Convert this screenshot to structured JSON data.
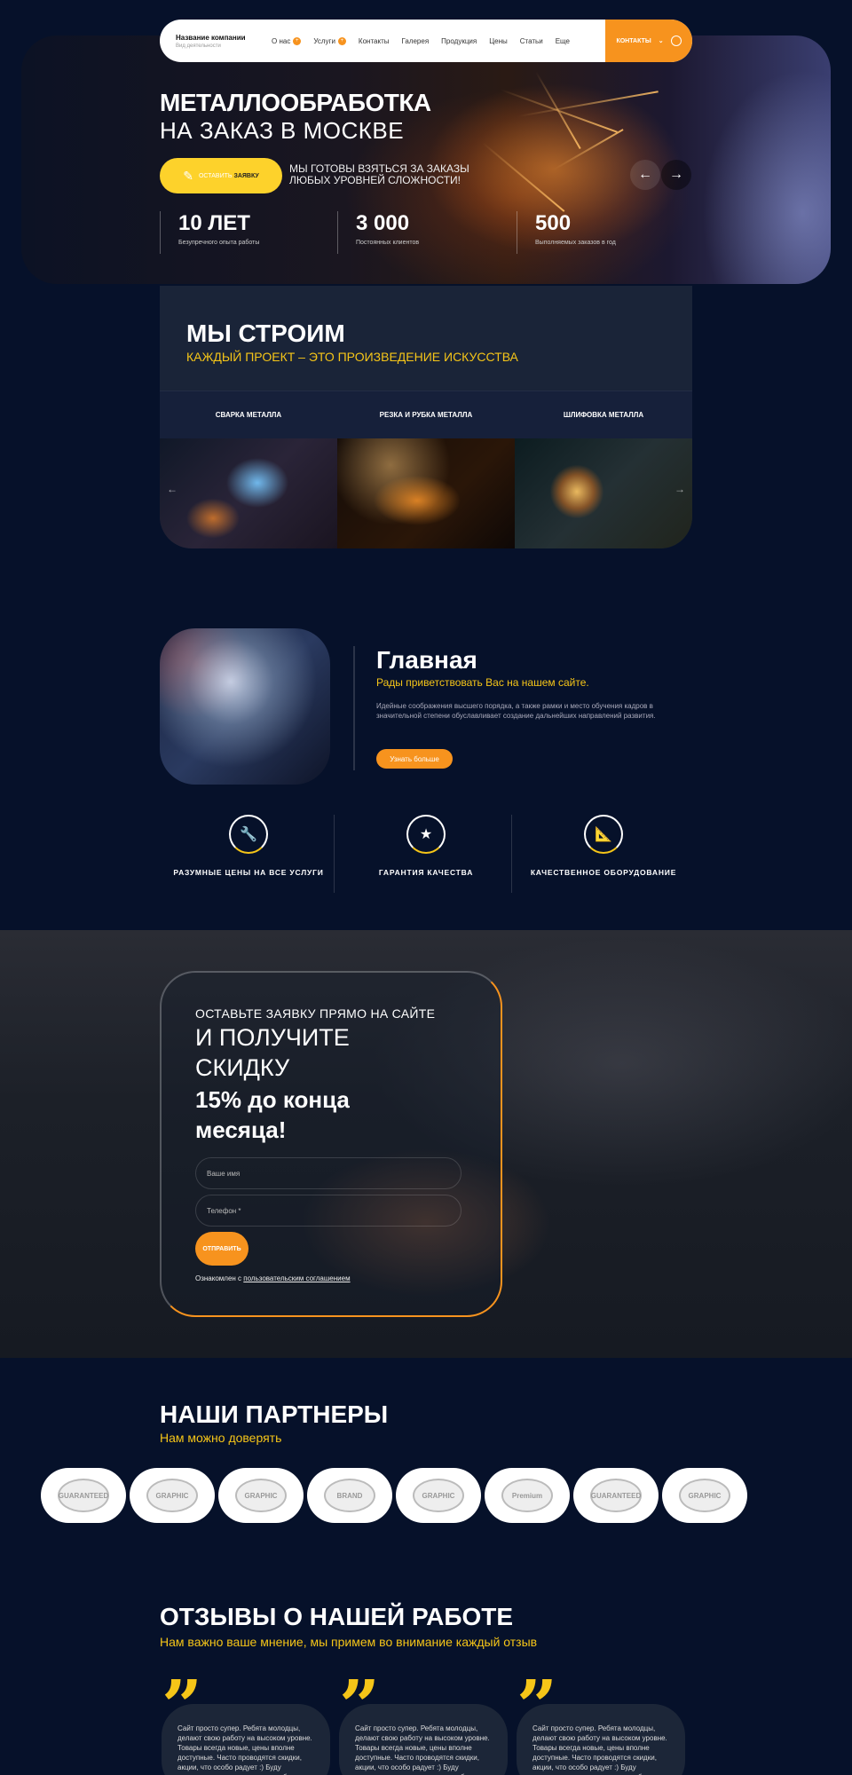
{
  "header": {
    "company_name": "Название компании",
    "company_sub": "Вид деятельности",
    "nav": [
      {
        "label": "О нас",
        "badge": "+"
      },
      {
        "label": "Услуги",
        "badge": "+"
      },
      {
        "label": "Контакты"
      },
      {
        "label": "Галерея"
      },
      {
        "label": "Продукция"
      },
      {
        "label": "Цены"
      },
      {
        "label": "Статьи"
      },
      {
        "label": "Еще"
      }
    ],
    "contacts_label": "КОНТАКТЫ"
  },
  "hero": {
    "title": "МЕТАЛЛООБРАБОТКА",
    "subtitle": "НА ЗАКАЗ В МОСКВЕ",
    "button_prefix": "ОСТАВИТЬ",
    "button_bold": "ЗАЯВКУ",
    "tagline": "МЫ ГОТОВЫ ВЗЯТЬСЯ ЗА ЗАКАЗЫ ЛЮБЫХ УРОВНЕЙ СЛОЖНОСТИ!",
    "stats": [
      {
        "value": "10 ЛЕТ",
        "label": "Безупречного опыта работы"
      },
      {
        "value": "3 000",
        "label": "Постоянных клиентов"
      },
      {
        "value": "500",
        "label": "Выполняемых заказов в год"
      }
    ]
  },
  "build": {
    "title": "МЫ СТРОИМ",
    "subtitle": "КАЖДЫЙ ПРОЕКТ – ЭТО ПРОИЗВЕДЕНИЕ ИСКУССТВА",
    "tabs": [
      "СВАРКА МЕТАЛЛА",
      "РЕЗКА И РУБКА МЕТАЛЛА",
      "ШЛИФОВКА МЕТАЛЛА"
    ]
  },
  "main": {
    "title": "Главная",
    "subtitle": "Рады приветствовать Вас на нашем сайте.",
    "text": "Идейные соображения высшего порядка, а также рамки и место обучения кадров в значительной степени обуславливает создание дальнейших направлений развития.",
    "button": "Узнать больше",
    "features": [
      {
        "label": "РАЗУМНЫЕ ЦЕНЫ НА ВСЕ УСЛУГИ",
        "icon": "wrench-icon"
      },
      {
        "label": "ГАРАНТИЯ КАЧЕСТВА",
        "icon": "medal-icon"
      },
      {
        "label": "КАЧЕСТВЕННОЕ ОБОРУДОВАНИЕ",
        "icon": "ruler-icon"
      }
    ]
  },
  "discount": {
    "line1": "ОСТАВЬТЕ ЗАЯВКУ ПРЯМО НА САЙТЕ",
    "line2": "И ПОЛУЧИТЕ СКИДКУ",
    "line3": "15% до конца месяца!",
    "name_placeholder": "Ваше имя",
    "phone_placeholder": "Телефон *",
    "submit": "ОТПРАВИТЬ",
    "agree_prefix": "Ознакомлен с",
    "agree_link": "пользовательским соглашением"
  },
  "partners": {
    "title": "НАШИ ПАРТНЕРЫ",
    "subtitle": "Нам можно доверять",
    "logos": [
      "GUARANTEED",
      "GRAPHIC",
      "GRAPHIC",
      "BRAND",
      "GRAPHIC",
      "Premium",
      "GUARANTEED",
      "GRAPHIC"
    ]
  },
  "reviews": {
    "title": "ОТЗЫВЫ О НАШЕЙ РАБОТЕ",
    "subtitle": "Нам важно ваше мнение, мы примем во внимание каждый отзыв",
    "items": [
      "Сайт просто супер. Ребята молодцы, делают свою работу на высоком уровне. Товары всегда новые, цены вполне доступные. Часто проводятся скидки, акции, что особо радует :) Буду рекомендовать всем друзьям и близким.",
      "Сайт просто супер. Ребята молодцы, делают свою работу на высоком уровне. Товары всегда новые, цены вполне доступные. Часто проводятся скидки, акции, что особо радует :) Буду рекомендовать всем друзьям и близким.",
      "Сайт просто супер. Ребята молодцы, делают свою работу на высоком уровне. Товары всегда новые, цены вполне доступные. Часто проводятся скидки, акции, что особо радует :) Буду рекомендовать всем друзьям и близким."
    ]
  },
  "colors": {
    "accent": "#f7931e",
    "yellow": "#fdd22b",
    "background": "#06112a"
  }
}
